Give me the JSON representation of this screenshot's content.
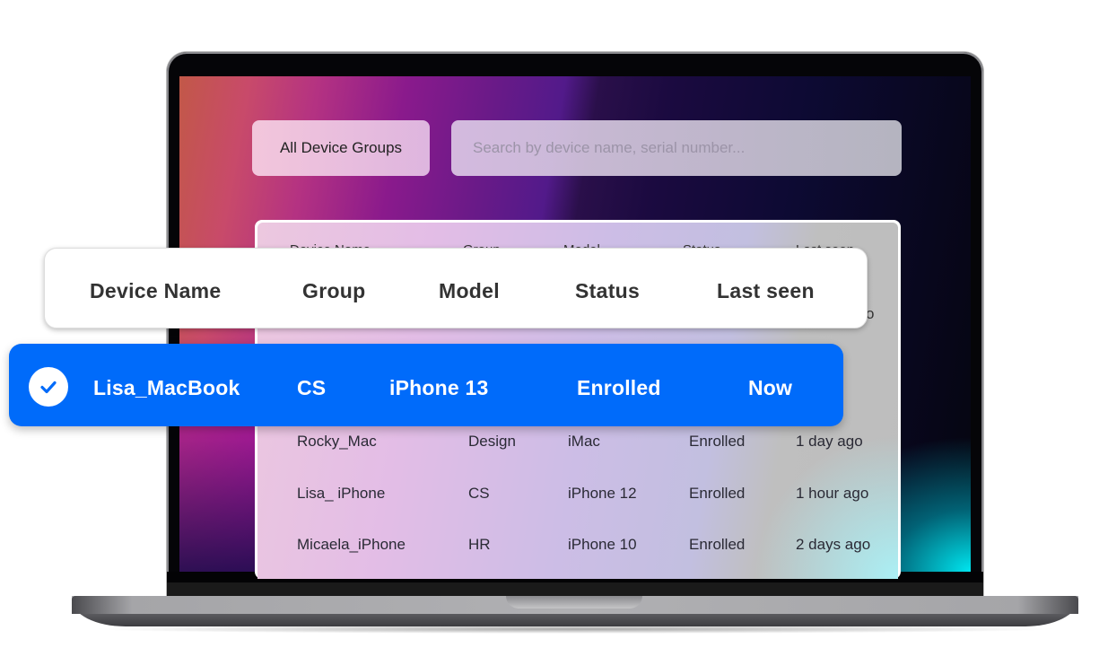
{
  "toolbar": {
    "group_filter_label": "All Device Groups",
    "search_placeholder": "Search by device name, serial number..."
  },
  "table": {
    "columns": [
      "Device Name",
      "Group",
      "Model",
      "Status",
      "Last seen"
    ],
    "partial_hidden_cell": "o",
    "rows": [
      {
        "device": "Rocky_Mac",
        "group": "Design",
        "model": "iMac",
        "status": "Enrolled",
        "last_seen": "1 day ago"
      },
      {
        "device": "Lisa_ iPhone",
        "group": "CS",
        "model": "iPhone 12",
        "status": "Enrolled",
        "last_seen": "1 hour ago"
      },
      {
        "device": "Micaela_iPhone",
        "group": "HR",
        "model": "iPhone 10",
        "status": "Enrolled",
        "last_seen": "2 days ago"
      }
    ]
  },
  "header_card": {
    "columns": [
      "Device Name",
      "Group",
      "Model",
      "Status",
      "Last seen"
    ]
  },
  "selected_row": {
    "icon": "check-circle-icon",
    "device": "Lisa_MacBook",
    "group": "CS",
    "model": "iPhone 13",
    "status": "Enrolled",
    "last_seen": "Now",
    "color": "#006bfa"
  }
}
